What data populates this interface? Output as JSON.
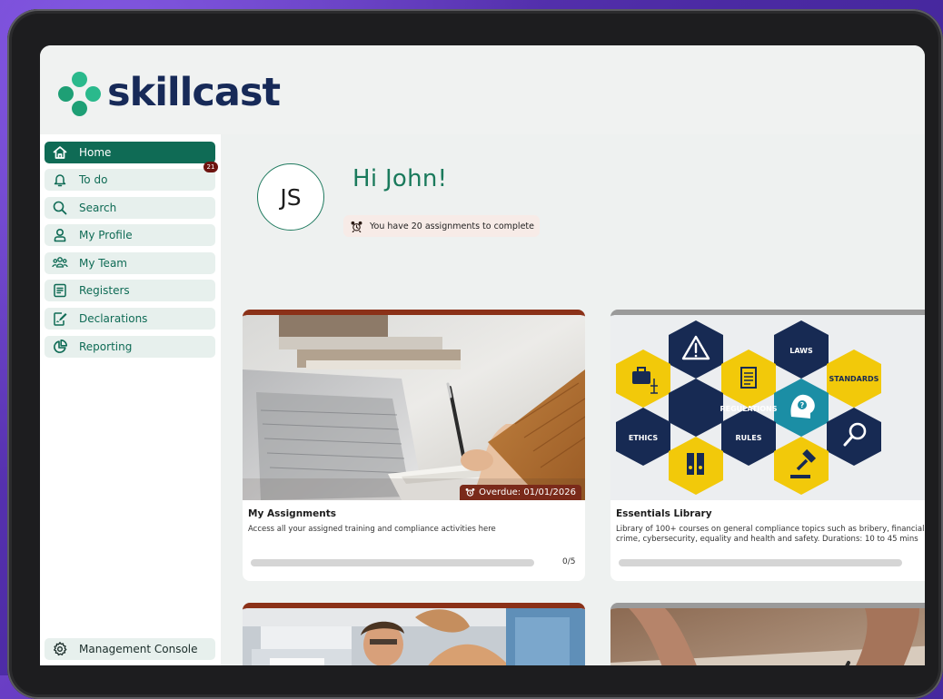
{
  "brand": {
    "name": "skillcast",
    "logo_color": "#172a58",
    "accent": "#0f6b55"
  },
  "sidebar": {
    "items": [
      {
        "label": "Home",
        "icon": "home-icon",
        "active": true
      },
      {
        "label": "To do",
        "icon": "bell-icon",
        "badge": "21"
      },
      {
        "label": "Search",
        "icon": "search-icon"
      },
      {
        "label": "My Profile",
        "icon": "profile-icon"
      },
      {
        "label": "My Team",
        "icon": "team-icon"
      },
      {
        "label": "Registers",
        "icon": "register-icon"
      },
      {
        "label": "Declarations",
        "icon": "declaration-icon"
      },
      {
        "label": "Reporting",
        "icon": "chart-icon"
      }
    ],
    "footer": {
      "label": "Management Console",
      "icon": "gear-icon"
    }
  },
  "header": {
    "initials": "JS",
    "greeting": "Hi John!",
    "assignments_notice": "You have 20 assignments to complete"
  },
  "cards": [
    {
      "title": "My Assignments",
      "description": "Access all your assigned training and compliance activities here",
      "overdue": "Overdue: 01/01/2026",
      "progress_text": "0/5",
      "progress_fraction": 0,
      "image": "desk-writing-photo"
    },
    {
      "title": "Essentials Library",
      "description": "Library of 100+ courses on general compliance topics such as bribery, financial crime, cybersecurity, equality and health and safety. Durations: 10 to 45 mins",
      "image": "compliance-hexagons",
      "hex_labels": [
        "LAWS",
        "STANDARDS",
        "REGULATIONS",
        "ETHICS",
        "RULES"
      ]
    },
    {
      "image": "office-team-photo"
    },
    {
      "image": "signing-document-photo"
    }
  ]
}
